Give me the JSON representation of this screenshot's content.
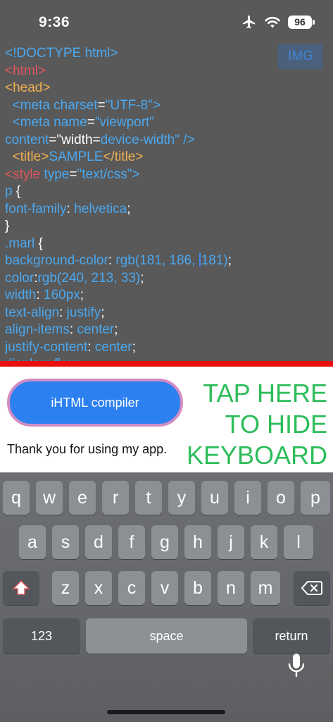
{
  "status_bar": {
    "time": "9:36",
    "battery": "96",
    "icons": [
      "airplane-icon",
      "wifi-icon",
      "battery-icon"
    ]
  },
  "editor": {
    "img_button": "IMG",
    "lines": [
      [
        {
          "t": "<!DOCTYPE html>",
          "c": "blue"
        }
      ],
      [
        {
          "t": "<html>",
          "c": "red"
        }
      ],
      [
        {
          "t": "<head>",
          "c": "orange"
        }
      ],
      [
        {
          "t": "  <meta ",
          "c": "blue"
        },
        {
          "t": "charset",
          "c": "blue"
        },
        {
          "t": "=",
          "c": "white"
        },
        {
          "t": "\"UTF-8\">",
          "c": "blue"
        }
      ],
      [
        {
          "t": "  <meta ",
          "c": "blue"
        },
        {
          "t": "name",
          "c": "blue"
        },
        {
          "t": "=",
          "c": "white"
        },
        {
          "t": "\"viewport\"",
          "c": "blue"
        }
      ],
      [
        {
          "t": "content",
          "c": "blue"
        },
        {
          "t": "=\"",
          "c": "white"
        },
        {
          "t": "width",
          "c": "white"
        },
        {
          "t": "=",
          "c": "white"
        },
        {
          "t": "device-width\" />",
          "c": "blue"
        }
      ],
      [
        {
          "t": "  <title>",
          "c": "orange"
        },
        {
          "t": "SAMPLE",
          "c": "blue"
        },
        {
          "t": "</title>",
          "c": "orange"
        }
      ],
      [
        {
          "t": "<style ",
          "c": "red"
        },
        {
          "t": "type",
          "c": "blue"
        },
        {
          "t": "=",
          "c": "white"
        },
        {
          "t": "\"text/css\">",
          "c": "blue"
        }
      ],
      [
        {
          "t": "p ",
          "c": "blue"
        },
        {
          "t": "{",
          "c": "white"
        }
      ],
      [
        {
          "t": "font-family",
          "c": "blue"
        },
        {
          "t": ": ",
          "c": "white"
        },
        {
          "t": "helvetica",
          "c": "blue"
        },
        {
          "t": ";",
          "c": "white"
        }
      ],
      [
        {
          "t": "}",
          "c": "white"
        }
      ],
      [
        {
          "t": ".marl ",
          "c": "blue"
        },
        {
          "t": "{",
          "c": "white"
        }
      ],
      [
        {
          "t": "background-color",
          "c": "blue"
        },
        {
          "t": ": ",
          "c": "white"
        },
        {
          "t": "rgb(181, 186, ",
          "c": "blue"
        },
        {
          "cursor": true
        },
        {
          "t": "181)",
          "c": "blue"
        },
        {
          "t": ";",
          "c": "white"
        }
      ],
      [
        {
          "t": "color",
          "c": "blue"
        },
        {
          "t": ":",
          "c": "white"
        },
        {
          "t": "rgb(240, 213, 33)",
          "c": "blue"
        },
        {
          "t": ";",
          "c": "white"
        }
      ],
      [
        {
          "t": "width",
          "c": "blue"
        },
        {
          "t": ": ",
          "c": "white"
        },
        {
          "t": "160px",
          "c": "blue"
        },
        {
          "t": ";",
          "c": "white"
        }
      ],
      [
        {
          "t": "text-align",
          "c": "blue"
        },
        {
          "t": ": ",
          "c": "white"
        },
        {
          "t": "justify",
          "c": "blue"
        },
        {
          "t": ";",
          "c": "white"
        }
      ],
      [
        {
          "t": "align-items",
          "c": "blue"
        },
        {
          "t": ": ",
          "c": "white"
        },
        {
          "t": "center",
          "c": "blue"
        },
        {
          "t": ";",
          "c": "white"
        }
      ],
      [
        {
          "t": "justify-content",
          "c": "blue"
        },
        {
          "t": ": ",
          "c": "white"
        },
        {
          "t": "center",
          "c": "blue"
        },
        {
          "t": ";",
          "c": "white"
        }
      ],
      [
        {
          "t": "display: flex;",
          "c": "blue"
        }
      ]
    ]
  },
  "preview": {
    "button_label": "iHTML compiler",
    "thank_you": "Thank you for using my app.",
    "tap_hide_lines": [
      "TAP HERE",
      "TO HIDE",
      "KEYBOARD"
    ]
  },
  "keyboard": {
    "row1": [
      "q",
      "w",
      "e",
      "r",
      "t",
      "y",
      "u",
      "i",
      "o",
      "p"
    ],
    "row2": [
      "a",
      "s",
      "d",
      "f",
      "g",
      "h",
      "j",
      "k",
      "l"
    ],
    "row3": [
      "z",
      "x",
      "c",
      "v",
      "b",
      "n",
      "m"
    ],
    "numbers_key": "123",
    "space_key": "space",
    "return_key": "return",
    "icons": [
      "shift-icon",
      "backspace-icon",
      "microphone-icon"
    ]
  },
  "colors": {
    "background": "#595959",
    "code_blue": "#4aa8f0",
    "code_red": "#e0575c",
    "code_orange": "#f0b050",
    "divider_red": "#e8100e",
    "button_blue": "#2d80f0",
    "button_border": "#d18cc4",
    "tap_hide_green": "#2dbd5a"
  }
}
